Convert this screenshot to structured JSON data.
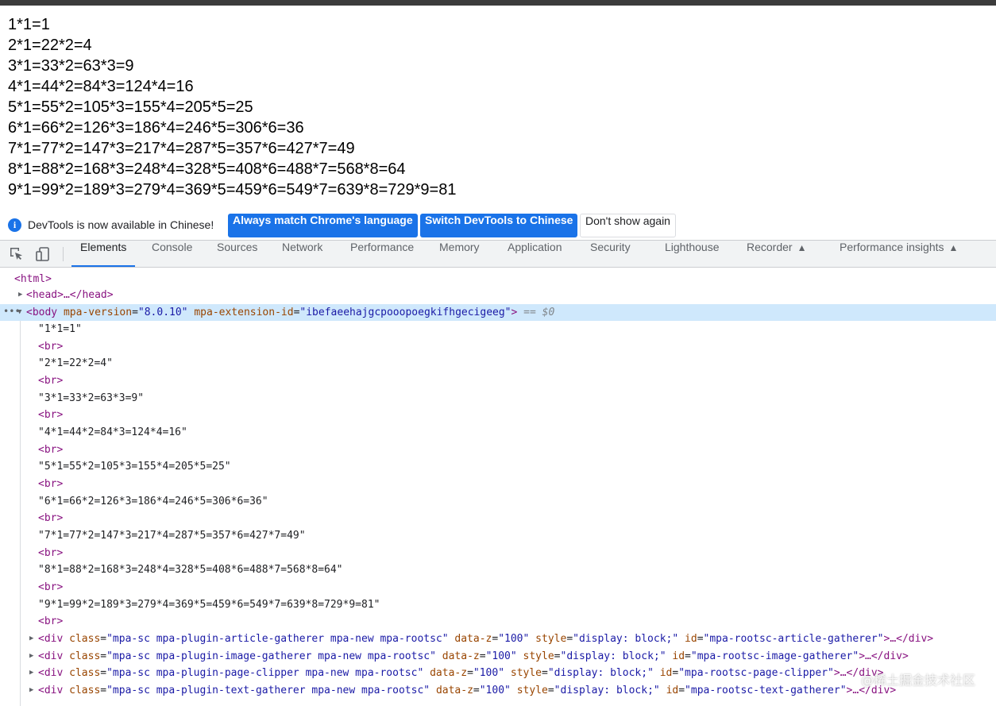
{
  "page_lines": [
    "1*1=1",
    "2*1=22*2=4",
    "3*1=33*2=63*3=9",
    "4*1=44*2=84*3=124*4=16",
    "5*1=55*2=105*3=155*4=205*5=25",
    "6*1=66*2=126*3=186*4=246*5=306*6=36",
    "7*1=77*2=147*3=217*4=287*5=357*6=427*7=49",
    "8*1=88*2=168*3=248*4=328*5=408*6=488*7=568*8=64",
    "9*1=99*2=189*3=279*4=369*5=459*6=549*7=639*8=729*9=81"
  ],
  "infobar": {
    "message": "DevTools is now available in Chinese!",
    "btn_match": "Always match Chrome's language",
    "btn_switch": "Switch DevTools to Chinese",
    "btn_dismiss": "Don't show again"
  },
  "tabs": [
    "Elements",
    "Console",
    "Sources",
    "Network",
    "Performance",
    "Memory",
    "Application",
    "Security",
    "Lighthouse",
    "Recorder",
    "Performance insights"
  ],
  "dom": {
    "html": "<html>",
    "head": "<head>…</head>",
    "body_open": "<body",
    "body_attr1_name": "mpa-version",
    "body_attr1_val": "\"8.0.10\"",
    "body_attr2_name": "mpa-extension-id",
    "body_attr2_val": "\"ibefaeehajgcpooopoegkifhgecigeeg\"",
    "body_close": ">",
    "body_ref": "== $0",
    "br": "<br>",
    "text_nodes": [
      "\"1*1=1\"",
      "\"2*1=22*2=4\"",
      "\"3*1=33*2=63*3=9\"",
      "\"4*1=44*2=84*3=124*4=16\"",
      "\"5*1=55*2=105*3=155*4=205*5=25\"",
      "\"6*1=66*2=126*3=186*4=246*5=306*6=36\"",
      "\"7*1=77*2=147*3=217*4=287*5=357*6=427*7=49\"",
      "\"8*1=88*2=168*3=248*4=328*5=408*6=488*7=568*8=64\"",
      "\"9*1=99*2=189*3=279*4=369*5=459*6=549*7=639*8=729*9=81\""
    ],
    "divs": [
      {
        "cls": "\"mpa-sc mpa-plugin-article-gatherer mpa-new mpa-rootsc\"",
        "z": "\"100\"",
        "style": "\"display: block;\"",
        "id": "\"mpa-rootsc-article-gatherer\""
      },
      {
        "cls": "\"mpa-sc mpa-plugin-image-gatherer mpa-new mpa-rootsc\"",
        "z": "\"100\"",
        "style": "\"display: block;\"",
        "id": "\"mpa-rootsc-image-gatherer\""
      },
      {
        "cls": "\"mpa-sc mpa-plugin-page-clipper mpa-new mpa-rootsc\"",
        "z": "\"100\"",
        "style": "\"display: block;\"",
        "id": "\"mpa-rootsc-page-clipper\""
      },
      {
        "cls": "\"mpa-sc mpa-plugin-text-gatherer mpa-new mpa-rootsc\"",
        "z": "\"100\"",
        "style": "\"display: block;\"",
        "id": "\"mpa-rootsc-text-gatherer\""
      }
    ],
    "div_open": "<div",
    "attr_class": "class",
    "attr_dataz": "data-z",
    "attr_style": "style",
    "attr_id": "id",
    "div_tail": ">…</div>"
  },
  "watermark": "@稀土掘金技术社区"
}
